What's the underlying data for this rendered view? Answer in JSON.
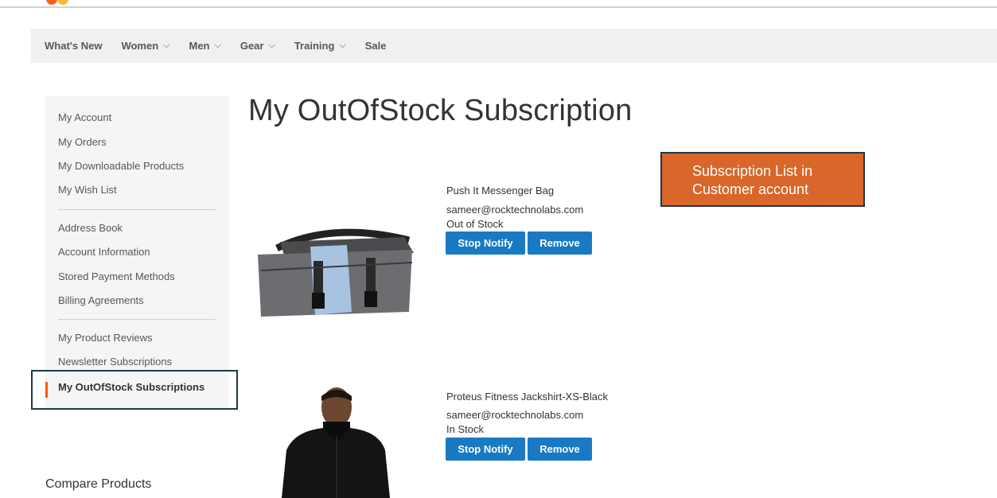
{
  "nav": {
    "items": [
      {
        "label": "What's New",
        "has_dropdown": false
      },
      {
        "label": "Women",
        "has_dropdown": true
      },
      {
        "label": "Men",
        "has_dropdown": true
      },
      {
        "label": "Gear",
        "has_dropdown": true
      },
      {
        "label": "Training",
        "has_dropdown": true
      },
      {
        "label": "Sale",
        "has_dropdown": false
      }
    ],
    "chevron": "⌵"
  },
  "sidebar": {
    "items": [
      {
        "label": "My Account"
      },
      {
        "label": "My Orders"
      },
      {
        "label": "My Downloadable Products"
      },
      {
        "label": "My Wish List"
      },
      {
        "label": "Address Book"
      },
      {
        "label": "Account Information"
      },
      {
        "label": "Stored Payment Methods"
      },
      {
        "label": "Billing Agreements"
      },
      {
        "label": "My Product Reviews"
      },
      {
        "label": "Newsletter Subscriptions"
      },
      {
        "label": "My OutOfStock Subscriptions",
        "current": true
      }
    ],
    "accent_color": "#ff5501"
  },
  "compare": {
    "label": "Compare Products"
  },
  "page": {
    "title": "My OutOfStock Subscription"
  },
  "callout": {
    "line1": "Subscription List in",
    "line2": "Customer account",
    "color": "#d9662a"
  },
  "subscriptions": [
    {
      "name": "Push It Messenger Bag",
      "email": "sameer@rocktechnolabs.com",
      "stock": "Out of Stock",
      "stop_label": "Stop Notify",
      "remove_label": "Remove",
      "image": "messenger-bag-image"
    },
    {
      "name": "Proteus Fitness Jackshirt-XS-Black",
      "email": "sameer@rocktechnolabs.com",
      "stock": "In Stock",
      "stop_label": "Stop Notify",
      "remove_label": "Remove",
      "image": "jackshirt-image"
    }
  ],
  "colors": {
    "primary_button": "#1979c3",
    "nav_bg": "#f0f0f0",
    "sidebar_bg": "#f5f5f5"
  }
}
